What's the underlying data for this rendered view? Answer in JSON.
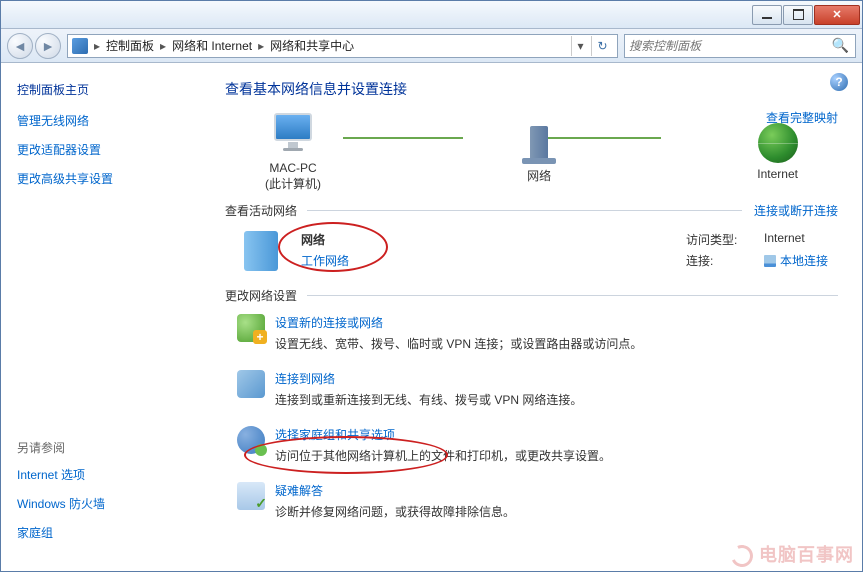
{
  "breadcrumb": {
    "seg1": "控制面板",
    "seg2": "网络和 Internet",
    "seg3": "网络和共享中心"
  },
  "search": {
    "placeholder": "搜索控制面板"
  },
  "sidebar": {
    "home": "控制面板主页",
    "links": [
      "管理无线网络",
      "更改适配器设置",
      "更改高级共享设置"
    ],
    "alsosee_hdr": "另请参阅",
    "alsosee": [
      "Internet 选项",
      "Windows 防火墙",
      "家庭组"
    ]
  },
  "page": {
    "title": "查看基本网络信息并设置连接",
    "fullmap": "查看完整映射",
    "map": {
      "node1": "MAC-PC",
      "node1_sub": "(此计算机)",
      "node2": "网络",
      "node3": "Internet"
    },
    "active_hdr": "查看活动网络",
    "active_link": "连接或断开连接",
    "active": {
      "name": "网络",
      "type": "工作网络",
      "access_lbl": "访问类型:",
      "access_val": "Internet",
      "conn_lbl": "连接:",
      "conn_val": "本地连接"
    },
    "change_hdr": "更改网络设置",
    "settings": [
      {
        "title": "设置新的连接或网络",
        "desc": "设置无线、宽带、拨号、临时或 VPN 连接；或设置路由器或访问点。"
      },
      {
        "title": "连接到网络",
        "desc": "连接到或重新连接到无线、有线、拨号或 VPN 网络连接。"
      },
      {
        "title": "选择家庭组和共享选项",
        "desc": "访问位于其他网络计算机上的文件和打印机，或更改共享设置。"
      },
      {
        "title": "疑难解答",
        "desc": "诊断并修复网络问题，或获得故障排除信息。"
      }
    ]
  },
  "watermark": "电脑百事网"
}
